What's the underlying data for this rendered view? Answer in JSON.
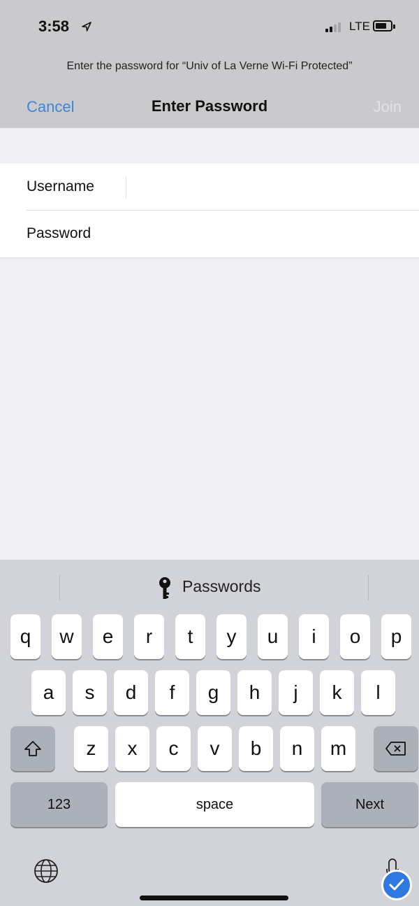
{
  "status": {
    "time": "3:58",
    "carrier": "LTE"
  },
  "header": {
    "prompt": "Enter the password for “Univ of La Verne Wi-Fi Protected”",
    "cancel": "Cancel",
    "title": "Enter Password",
    "join": "Join"
  },
  "form": {
    "username_label": "Username",
    "username_value": "",
    "password_label": "Password",
    "password_value": ""
  },
  "keyboard": {
    "quicktype_label": "Passwords",
    "row1": [
      "q",
      "w",
      "e",
      "r",
      "t",
      "y",
      "u",
      "i",
      "o",
      "p"
    ],
    "row2": [
      "a",
      "s",
      "d",
      "f",
      "g",
      "h",
      "j",
      "k",
      "l"
    ],
    "row3": [
      "z",
      "x",
      "c",
      "v",
      "b",
      "n",
      "m"
    ],
    "numbers_key": "123",
    "space_key": "space",
    "next_key": "Next"
  },
  "colors": {
    "accent": "#3d86d8",
    "header_bg": "#cacacc",
    "keyboard_bg": "#d1d3d9"
  }
}
